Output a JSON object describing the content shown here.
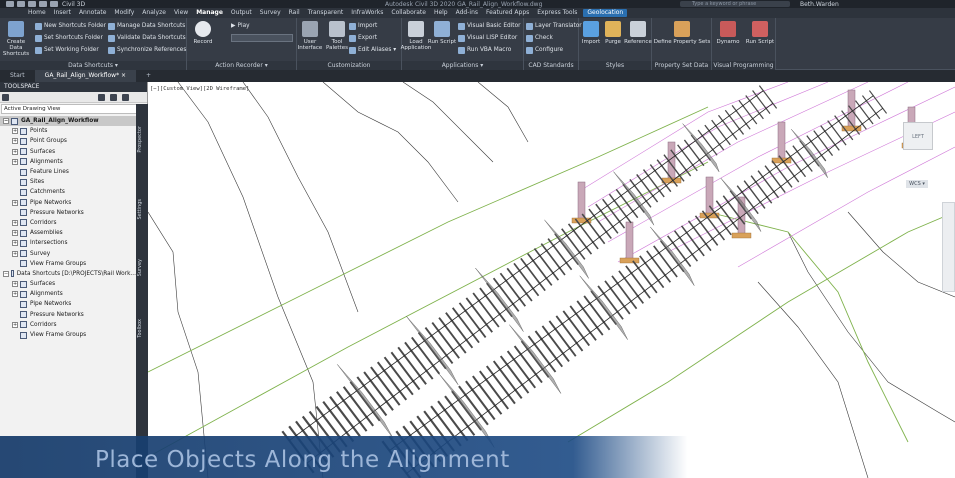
{
  "titlebar": {
    "workspace": "Civil 3D",
    "app_title": "Autodesk Civil 3D 2020   GA_Rail_Align_Workflow.dwg",
    "search_placeholder": "Type a keyword or phrase",
    "user": "Beth.Warden"
  },
  "tabs": [
    "Home",
    "Insert",
    "Annotate",
    "Modify",
    "Analyze",
    "View",
    "Manage",
    "Output",
    "Survey",
    "Rail",
    "Transparent",
    "InfraWorks",
    "Collaborate",
    "Help",
    "Add-ins",
    "Featured Apps",
    "Express Tools",
    "Geolocation"
  ],
  "active_tab": "Manage",
  "ribbon": {
    "data_shortcuts": {
      "title": "Data Shortcuts ▾",
      "big": "Create Data Shortcuts",
      "items": [
        "New Shortcuts Folder",
        "Set Shortcuts Folder",
        "Set Working Folder",
        "Manage Data Shortcuts",
        "Validate Data Shortcuts",
        "Synchronize References"
      ]
    },
    "action_recorder": {
      "title": "Action Recorder ▾",
      "record": "Record",
      "play": "Play"
    },
    "customization": {
      "title": "Customization",
      "user_interface": "User Interface",
      "tool_palettes": "Tool Palettes",
      "import": "Import",
      "export": "Export",
      "edit_aliases": "Edit Aliases ▾"
    },
    "applications": {
      "title": "Applications ▾",
      "load_application": "Load Application",
      "run_script": "Run Script",
      "vba": "Visual Basic Editor",
      "lisp": "Visual LISP Editor",
      "run_vba": "Run VBA Macro"
    },
    "cad_standards": {
      "title": "CAD Standards",
      "layer_translator": "Layer Translator",
      "check": "Check",
      "configure": "Configure"
    },
    "styles": {
      "title": "Styles",
      "import": "Import",
      "purge": "Purge",
      "reference": "Reference"
    },
    "property_set_data": {
      "title": "Property Set Data",
      "define": "Define Property Sets"
    },
    "visual_programming": {
      "title": "Visual Programming",
      "dynamo": "Dynamo",
      "run_script": "Run Script"
    }
  },
  "doc_tabs": [
    "Start",
    "GA_Rail_Align_Workflow* ×",
    "+"
  ],
  "toolspace": {
    "header": "TOOLSPACE",
    "combo": "Active Drawing View",
    "side_tabs": [
      "Prospector",
      "Settings",
      "Survey",
      "Toolbox"
    ],
    "tree": [
      {
        "label": "GA_Rail_Align_Workflow",
        "level": 0,
        "exp": "−",
        "sel": true
      },
      {
        "label": "Points",
        "level": 1,
        "exp": "+"
      },
      {
        "label": "Point Groups",
        "level": 1,
        "exp": "+"
      },
      {
        "label": "Surfaces",
        "level": 1,
        "exp": "+"
      },
      {
        "label": "Alignments",
        "level": 1,
        "exp": "+"
      },
      {
        "label": "Feature Lines",
        "level": 1,
        "exp": ""
      },
      {
        "label": "Sites",
        "level": 1,
        "exp": ""
      },
      {
        "label": "Catchments",
        "level": 1,
        "exp": ""
      },
      {
        "label": "Pipe Networks",
        "level": 1,
        "exp": "+"
      },
      {
        "label": "Pressure Networks",
        "level": 1,
        "exp": ""
      },
      {
        "label": "Corridors",
        "level": 1,
        "exp": "+"
      },
      {
        "label": "Assemblies",
        "level": 1,
        "exp": "+"
      },
      {
        "label": "Intersections",
        "level": 1,
        "exp": "+"
      },
      {
        "label": "Survey",
        "level": 1,
        "exp": "+"
      },
      {
        "label": "View Frame Groups",
        "level": 1,
        "exp": ""
      },
      {
        "label": "Data Shortcuts [D:\\PROJECTS\\Rail Work...",
        "level": 0,
        "exp": "−"
      },
      {
        "label": "Surfaces",
        "level": 1,
        "exp": "+"
      },
      {
        "label": "Alignments",
        "level": 1,
        "exp": "+"
      },
      {
        "label": "Pipe Networks",
        "level": 1,
        "exp": ""
      },
      {
        "label": "Pressure Networks",
        "level": 1,
        "exp": ""
      },
      {
        "label": "Corridors",
        "level": 1,
        "exp": "+"
      },
      {
        "label": "View Frame Groups",
        "level": 1,
        "exp": ""
      }
    ]
  },
  "viewport": {
    "view_label": "[−][Custom View][2D Wireframe]",
    "viewcube_face": "LEFT",
    "wcs": "WCS ▾"
  },
  "caption": "Place Objects Along the Alignment",
  "colors": {
    "accent": "#2a6fb0",
    "caption_band": "#1c4a84",
    "caption_text": "#9db6d8",
    "rail_green": "#7fb24c",
    "structure_magenta": "#d07ad8",
    "pier_orange": "#d9a15a"
  }
}
